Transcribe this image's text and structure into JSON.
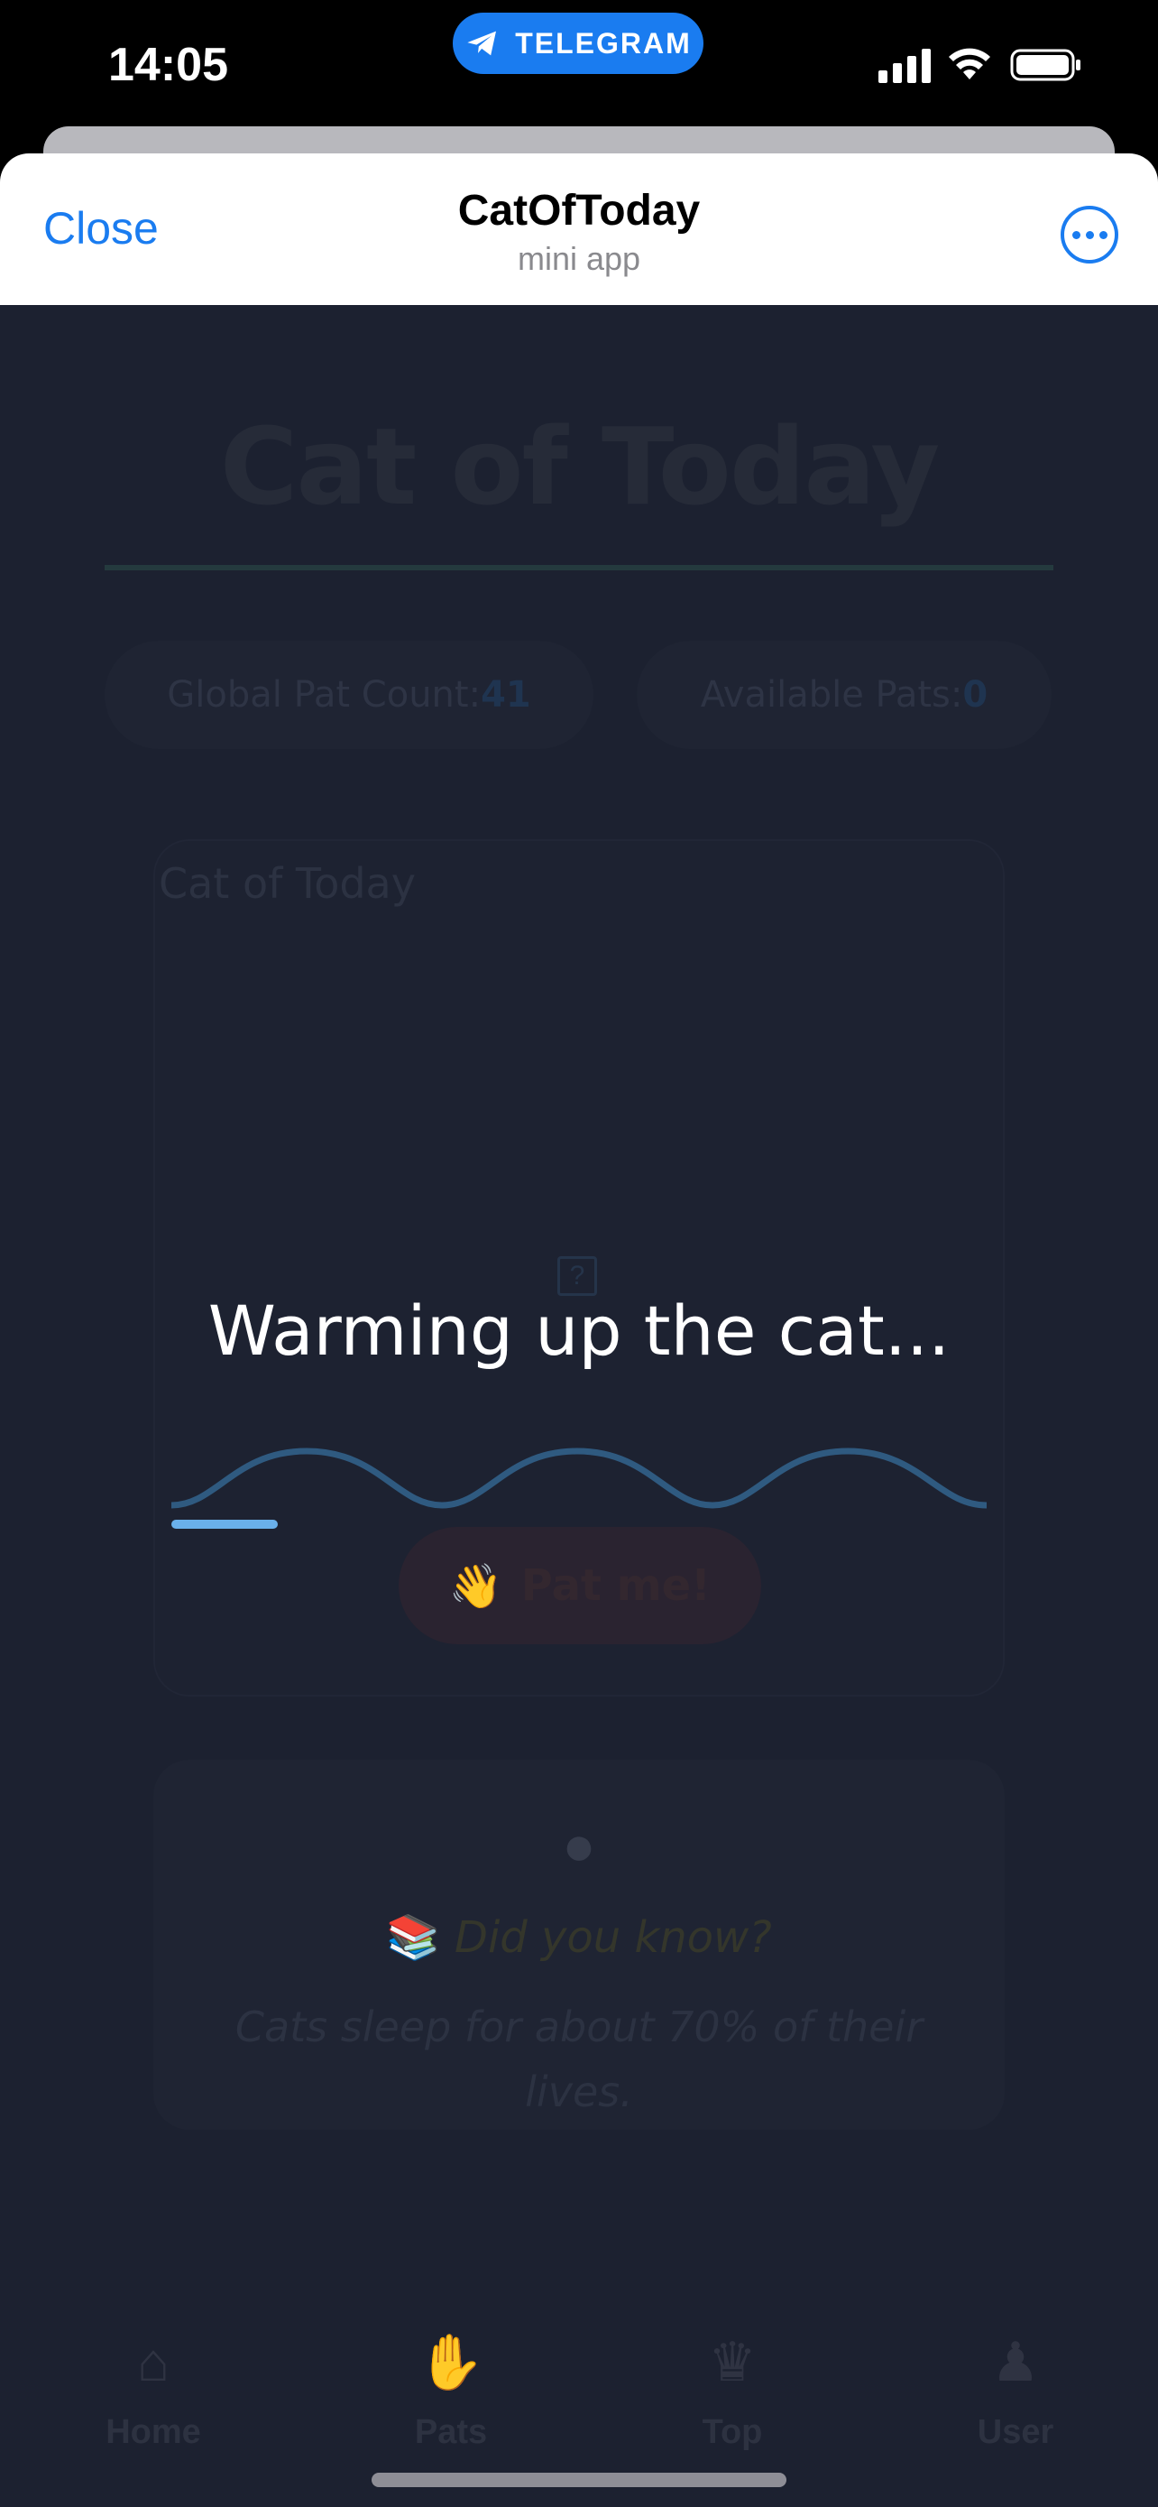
{
  "status_bar": {
    "time": "14:05",
    "app_badge": "TELEGRAM"
  },
  "header": {
    "close_label": "Close",
    "title": "CatOfToday",
    "subtitle": "mini app"
  },
  "page": {
    "title": "Cat of Today",
    "stats": {
      "global_label": "Global Pat Count:",
      "global_value": "41",
      "available_label": "Available Pats:",
      "available_value": "0"
    },
    "cat_card": {
      "label": "Cat of Today",
      "pat_button_emoji": "👋",
      "pat_button_label": "Pat me!"
    },
    "fact_card": {
      "heading_emoji": "📚",
      "heading": "Did you know?",
      "text": "Cats sleep for about 70% of their lives."
    },
    "bottom_nav": [
      {
        "label": "Home",
        "icon": "house-icon"
      },
      {
        "label": "Pats",
        "icon": "hand-icon"
      },
      {
        "label": "Top",
        "icon": "trophy-icon"
      },
      {
        "label": "User",
        "icon": "user-icon"
      }
    ]
  },
  "loading": {
    "text": "Warming up the cat...",
    "progress": 0.13
  },
  "colors": {
    "accent": "#1a7cf0",
    "webview_bg": "#1c2130",
    "progress": "#6ab0ea",
    "wave": "#2f5a80"
  }
}
